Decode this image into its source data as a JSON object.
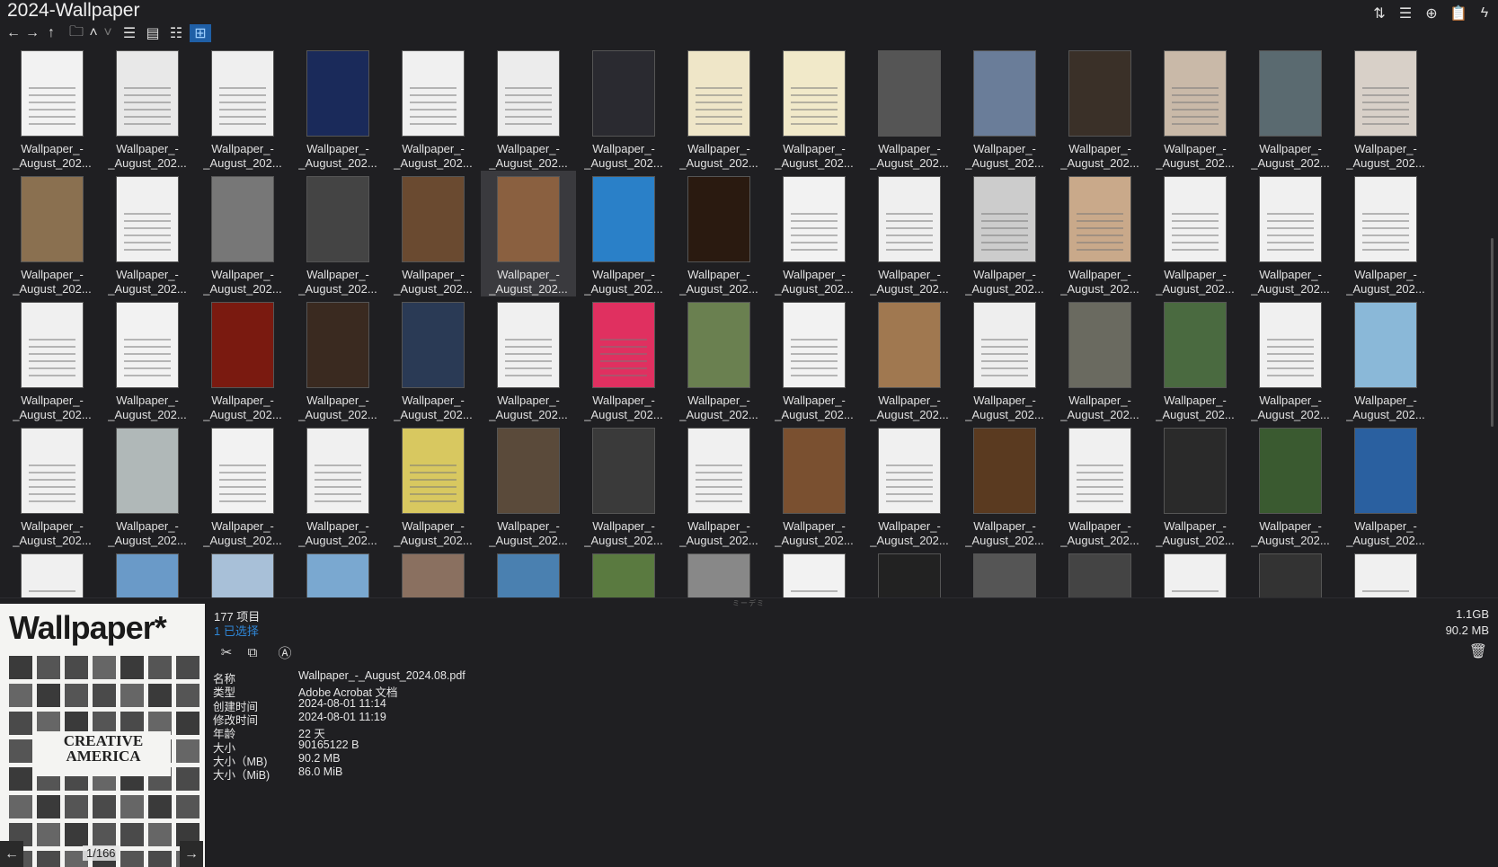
{
  "window": {
    "title": "2024-Wallpaper"
  },
  "toolbar": {
    "back": "←",
    "forward": "→",
    "up": "↑",
    "folder": "🗀",
    "collapse": "˄",
    "expand": "˅",
    "view_details": "☰",
    "view_tiles": "▤",
    "view_list": "☷",
    "view_thumbs": "⊞",
    "active_view": "thumbnails"
  },
  "top_right": {
    "sort": "⇅",
    "list": "☰",
    "add": "⊕",
    "clipboard": "📋",
    "quick": "ϟ"
  },
  "grid": {
    "line1": "Wallpaper_-",
    "line2": "_August_202...",
    "selected_index": 20,
    "tones": [
      "#f2f2f2",
      "#e8e8e8",
      "#efefef",
      "#1a2a5a",
      "#f0f0f0",
      "#ececec",
      "#2a2a30",
      "#efe6c8",
      "#f1e9c9",
      "#555555",
      "#6a7d99",
      "#3a3028",
      "#c9b9a8",
      "#5a6a70",
      "#d8d0c8",
      "#8a7050",
      "#f0f0f0",
      "#777777",
      "#444444",
      "#6a4a30",
      "#8a6040",
      "#2a80c8",
      "#2a1a10",
      "#f2f2f2",
      "#efefef",
      "#cccccc",
      "#c9a98a",
      "#f0f0f0",
      "#f0f0f0",
      "#f0f0f0",
      "#f0f0f0",
      "#f2f2f2",
      "#7a1a10",
      "#3a2a20",
      "#2a3a55",
      "#f0f0f0",
      "#e03060",
      "#6a8050",
      "#f2f2f2",
      "#a07850",
      "#eeeeee",
      "#6a6a60",
      "#4a6a40",
      "#f0f0f0",
      "#8ab8d8",
      "#f0f0f0",
      "#b0b8b8",
      "#f2f2f2",
      "#f0f0f0",
      "#d8c860",
      "#5a4a3a",
      "#3a3a3a",
      "#f0f0f0",
      "#7a5030",
      "#f0f0f0",
      "#5a3a20",
      "#f0f0f0",
      "#2a2a2a",
      "#3a5a30",
      "#2a60a0",
      "#f0f0f0",
      "#6a9ac8",
      "#a8c0d8",
      "#7aa8d0",
      "#8a7060",
      "#4a80b0",
      "#5a7a40",
      "#888888",
      "#f2f2f2",
      "#222222",
      "#555555",
      "#444444",
      "#f0f0f0",
      "#333333",
      "#f0f0f0"
    ]
  },
  "preview": {
    "masthead": "Wallpaper*",
    "headline": "CREATIVE AMERICA",
    "page": "1/166",
    "prev": "←",
    "next": "→"
  },
  "info": {
    "item_count": "177 项目",
    "selected": "1 已选择",
    "total_size": "1.1GB",
    "selected_size": "90.2 MB",
    "actions": {
      "cut": "✂",
      "copy": "⧉",
      "rename": "Ⓐ"
    },
    "trash": "🗑",
    "properties": [
      {
        "label": "名称",
        "value": "Wallpaper_-_August_2024.08.pdf"
      },
      {
        "label": "类型",
        "value": "Adobe Acrobat 文档"
      },
      {
        "label": "创建时间",
        "value": "2024-08-01  11:14"
      },
      {
        "label": "修改时间",
        "value": "2024-08-01  11:19"
      },
      {
        "label": "年龄",
        "value": "22 天"
      },
      {
        "label": "大小",
        "value": "90165122 B"
      },
      {
        "label": "大小（MB)",
        "value": "90.2 MB"
      },
      {
        "label": "大小（MiB)",
        "value": "86.0 MiB"
      }
    ]
  },
  "splitter": {
    "label": "ミーデミ"
  }
}
